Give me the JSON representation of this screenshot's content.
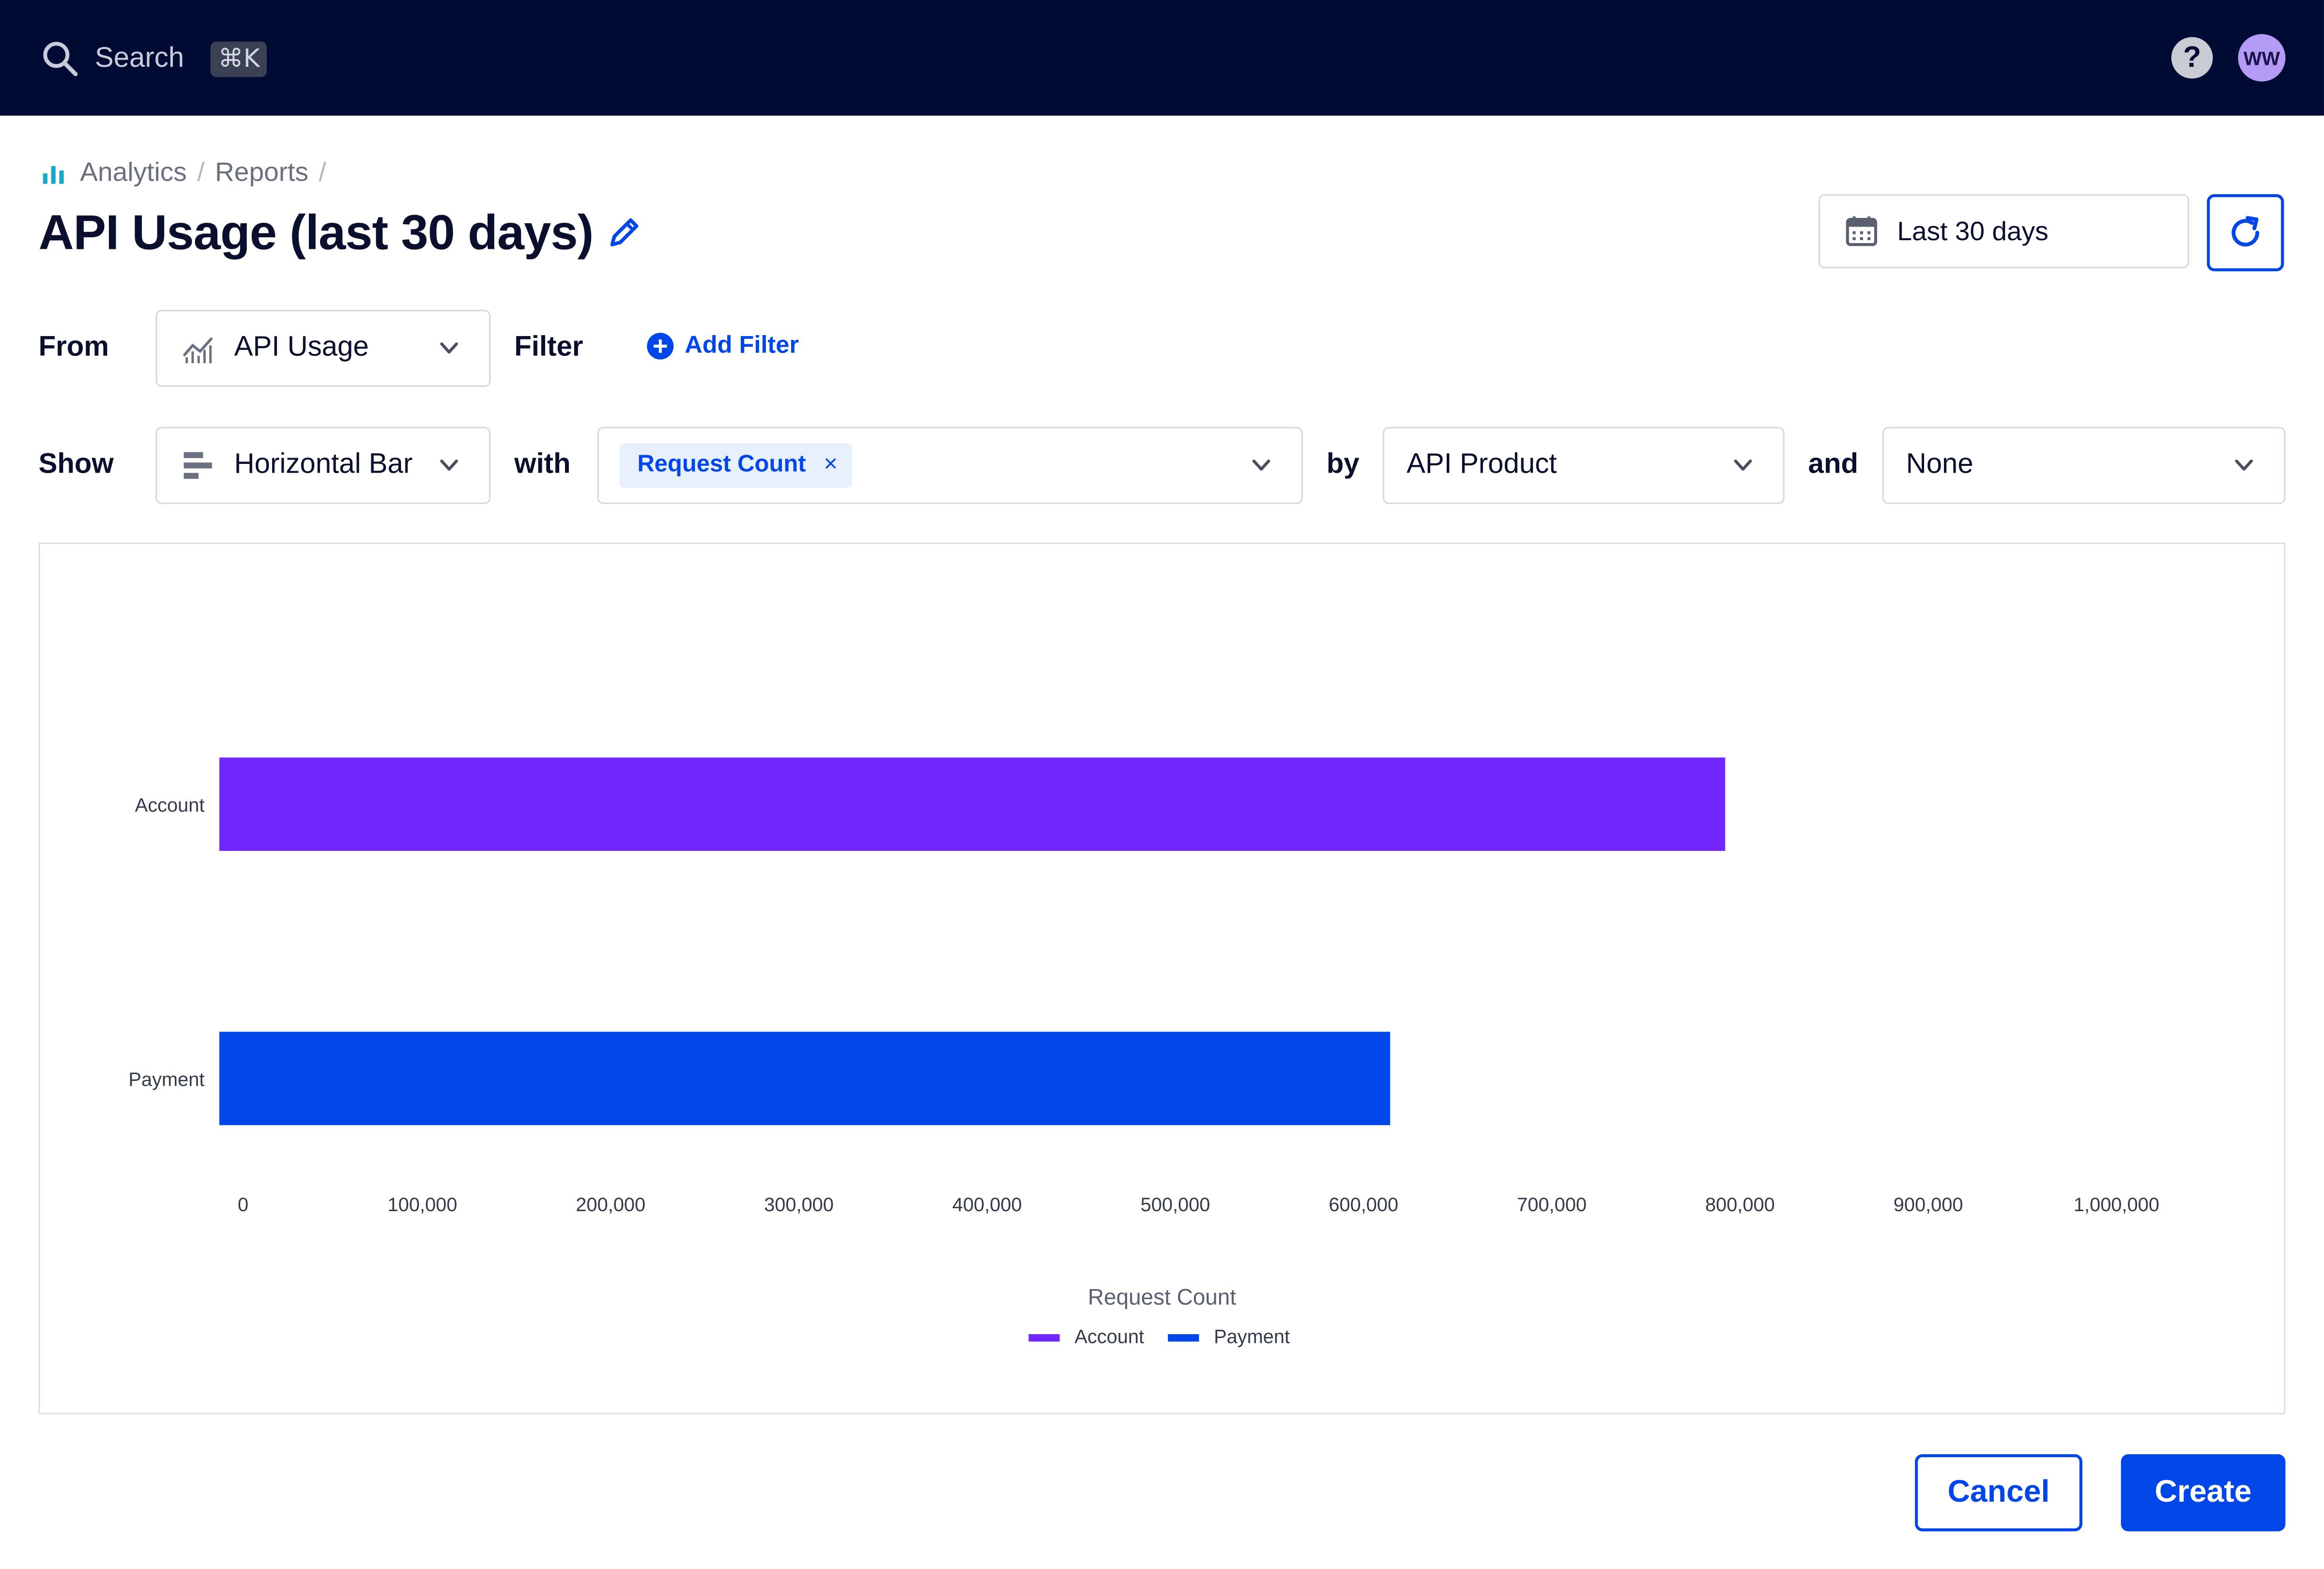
{
  "topbar": {
    "search_label": "Search",
    "shortcut": "⌘K",
    "help_label": "?",
    "avatar_initials": "WW"
  },
  "breadcrumb": {
    "items": [
      "Analytics",
      "Reports"
    ],
    "separator": "/"
  },
  "page": {
    "title": "API Usage (last 30 days)"
  },
  "date_range": {
    "label": "Last 30 days"
  },
  "query": {
    "from_label": "From",
    "from_value": "API Usage",
    "filter_label": "Filter",
    "add_filter_label": "Add Filter",
    "show_label": "Show",
    "show_value": "Horizontal Bar",
    "with_label": "with",
    "metric_chip": "Request Count",
    "chip_remove": "×",
    "by_label": "by",
    "by_value": "API Product",
    "and_label": "and",
    "and_value": "None"
  },
  "colors": {
    "accent": "#0046e8",
    "series_account": "#7028fe",
    "series_payment": "#0046e8",
    "topbar": "#000b33"
  },
  "chart_data": {
    "type": "bar",
    "orientation": "horizontal",
    "categories": [
      "Account",
      "Payment"
    ],
    "values": [
      800000,
      622000
    ],
    "colors": [
      "#7028fe",
      "#0046e8"
    ],
    "xlabel": "Request Count",
    "xlim": [
      0,
      1000000
    ],
    "x_ticks": [
      0,
      100000,
      200000,
      300000,
      400000,
      500000,
      600000,
      700000,
      800000,
      900000,
      1000000
    ],
    "x_tick_labels": [
      "0",
      "100,000",
      "200,000",
      "300,000",
      "400,000",
      "500,000",
      "600,000",
      "700,000",
      "800,000",
      "900,000",
      "1,000,000"
    ],
    "legend": [
      {
        "name": "Account",
        "color": "#7028fe"
      },
      {
        "name": "Payment",
        "color": "#0046e8"
      }
    ],
    "legend_position": "bottom-center",
    "grid": false
  },
  "actions": {
    "cancel_label": "Cancel",
    "create_label": "Create"
  }
}
